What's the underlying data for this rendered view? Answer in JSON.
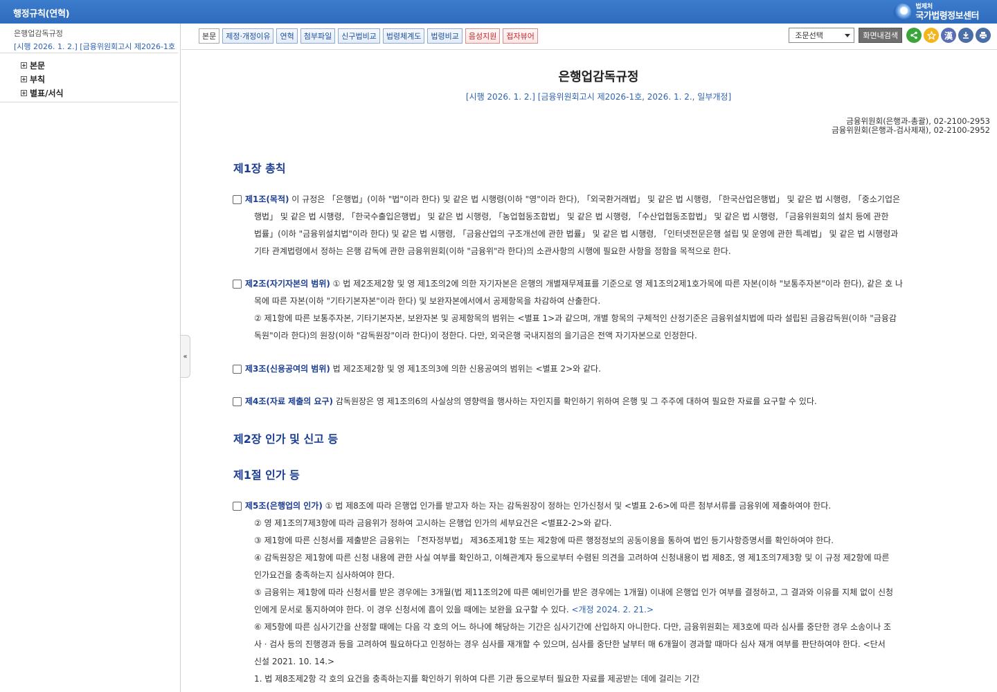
{
  "header": {
    "title": "행정규칙(연혁)",
    "logo_small": "법제처",
    "logo_big": "국가법령정보센터"
  },
  "sidebar": {
    "law_name": "은행업감독규정",
    "law_sub": "[시행 2026. 1. 2.] [금융위원회고시 제2026-1호",
    "items": [
      {
        "label": "본문"
      },
      {
        "label": "부칙"
      },
      {
        "label": "별표/서식"
      }
    ],
    "collapse_icon": "«"
  },
  "toolbar": {
    "buttons": [
      {
        "label": "본문"
      },
      {
        "label": "제정·개정이유"
      },
      {
        "label": "연혁"
      },
      {
        "label": "첨부파일"
      },
      {
        "label": "신구법비교"
      },
      {
        "label": "법령체계도"
      },
      {
        "label": "법령비교"
      },
      {
        "label": "음성지원"
      },
      {
        "label": "접자뷰어"
      }
    ],
    "select_value": "조문선택",
    "search_label": "화면내검색",
    "hanja_label": "漢",
    "icons": [
      "share-icon",
      "star-icon",
      "hanja-icon",
      "download-icon",
      "print-icon"
    ]
  },
  "document": {
    "title": "은행업감독규정",
    "subtitle": "[시행 2026. 1. 2.] [금융위원회고시 제2026-1호, 2026. 1. 2., 일부개정]",
    "contacts": [
      "금융위원회(은행과-총괄), 02-2100-2953",
      "금융위원회(은행과-검사제재), 02-2100-2952"
    ],
    "chapter1": "제1장 총칙",
    "art1": {
      "head": "제1조(목적)",
      "l1": " 이 규정은 「은행법」(이하 \"법\"이라 한다) 및 같은 법 시행령(이하 \"영\"이라 한다), 「외국환거래법」 및 같은 법 시행령, 「한국산업은행법」 및 같은 법 시행령, 「중소기업은",
      "l2": "행법」 및 같은 법 시행령, 「한국수출입은행법」 및 같은 법 시행령, 「농업협동조합법」 및 같은 법 시행령, 「수산업협동조합법」 및 같은 법 시행령, 「금융위원회의 설치 등에 관한",
      "l3": "법률」(이하 \"금융위설치법\"이라 한다) 및 같은 법 시행령, 「금융산업의 구조개선에 관한 법률」 및 같은 법 시행령, 「인터넷전문은행 설립 및 운영에 관한 특례법」 및 같은 법 시행령과",
      "l4": "기타 관계법령에서 정하는 은행 감독에 관한 금융위원회(이하 \"금융위\"라 한다)의 소관사항의 시행에 필요한 사항을 정함을 목적으로 한다."
    },
    "art2": {
      "head": "제2조(자기자본의 범위)",
      "l1": " ① 법 제2조제2항 및 영 제1조의2에 의한 자기자본은 은행의 개별재무제표를 기준으로 영 제1조의2제1호가목에 따른 자본(이하 \"보통주자본\"이라 한다), 같은 호 나",
      "l2": "목에 따른 자본(이하 \"기타기본자본\"이라 한다) 및 보완자본에서에서 공제항목을 차감하여 산출한다.",
      "l3": "② 제1항에 따른 보통주자본, 기타기본자본, 보완자본 및 공제항목의 범위는 <별표 1>과 같으며, 개별 항목의 구체적인 산정기준은 금융위설치법에 따라 설립된 금융감독원(이하 \"금융감",
      "l4": "독원\"이라 한다)의 원장(이하 \"감독원장\"이라 한다)이 정한다. 다만, 외국은행 국내지점의 을기금은 전액 자기자본으로 인정한다."
    },
    "art3": {
      "head": "제3조(신용공여의 범위)",
      "l1": " 법 제2조제2항 및 영 제1조의3에 의한 신용공여의 범위는 <별표 2>와 같다."
    },
    "art4": {
      "head": "제4조(자료 제출의 요구)",
      "l1": " 감독원장은 영 제1조의6의 사실상의 영향력을 행사하는 자인지를 확인하기 위하여 은행 및 그 주주에 대하여 필요한 자료를 요구할 수 있다."
    },
    "chapter2": "제2장 인가 및 신고 등",
    "section1": "제1절 인가 등",
    "art5": {
      "head": "제5조(은행업의 인가)",
      "l1": " ① 법 제8조에 따라 은행업 인가를 받고자 하는 자는 감독원장이 정하는 인가신청서 및 <별표 2-6>에 따른 첨부서류를 금융위에 제출하여야 한다.",
      "l2": "② 영 제1조의7제3항에 따라 금융위가 정하여 고시하는 은행업 인가의 세부요건은 <별표2-2>와 같다.",
      "l3": "③ 제1항에 따른 신청서를 제출받은 금융위는 「전자정부법」 제36조제1항 또는 제2항에 따른 행정정보의 공동이용을 통하여 법인 등기사항증명서를 확인하여야 한다.",
      "l4": "④ 감독원장은 제1항에 따른 신청 내용에 관한 사실 여부를 확인하고, 이해관계자 등으로부터 수렴된 의견을 고려하여 신청내용이 법 제8조, 영 제1조의7제3항 및 이 규정 제2항에 따른",
      "l5": "인가요건을 충족하는지 심사하여야 한다.",
      "l6": "⑤ 금융위는 제1항에 따라 신청서를 받은 경우에는 3개월(법 제11조의2에 따른 예비인가를 받은 경우에는 1개월) 이내에 은행업 인가 여부를 결정하고, 그 결과와 이유를 지체 없이 신청",
      "l7": "인에게 문서로 통지하여야 한다. 이 경우 신청서에 흠이 있을 때에는 보완을 요구할 수 있다. ",
      "l7_rev": "<개정 2024. 2. 21.>",
      "l8": "⑥ 제5항에 따른 심사기간을 산정할 때에는 다음 각 호의 어느 하나에 해당하는 기간은 심사기간에 산입하지 아니한다. 다만, 금융위원회는 제3호에 따라 심사를 중단한 경우 소송이나 조",
      "l9": "사ㆍ검사 등의 진행경과 등을 고려하여 필요하다고 인정하는 경우 심사를 재개할 수 있으며, 심사를 중단한 날부터 매 6개월이 경과할 때마다 심사 재개 여부를 판단하여야 한다. <단서",
      "l10": "신설 2021. 10. 14.>",
      "l11": "1. 법 제8조제2항 각 호의 요건을 충족하는지를 확인하기 위하여 다른 기관 등으로부터 필요한 자료를 제공받는 데에 걸리는 기간"
    }
  }
}
